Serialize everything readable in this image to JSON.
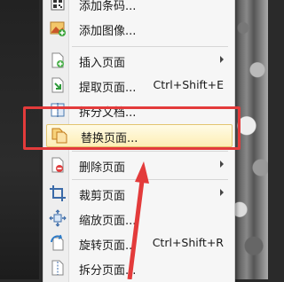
{
  "menu": {
    "items": [
      {
        "label": "添加条码...",
        "shortcut": "",
        "submenu": false,
        "icon": "barcode-icon"
      },
      {
        "label": "添加图像...",
        "shortcut": "",
        "submenu": false,
        "icon": "add-image-icon"
      },
      {
        "label": "插入页面",
        "shortcut": "",
        "submenu": true,
        "icon": "insert-page-icon"
      },
      {
        "label": "提取页面...",
        "shortcut": "Ctrl+Shift+E",
        "submenu": false,
        "icon": "extract-page-icon"
      },
      {
        "label": "拆分文档...",
        "shortcut": "",
        "submenu": false,
        "icon": "split-document-icon"
      },
      {
        "label": "替换页面...",
        "shortcut": "",
        "submenu": false,
        "icon": "replace-page-icon"
      },
      {
        "label": "删除页面",
        "shortcut": "",
        "submenu": true,
        "icon": "delete-page-icon"
      },
      {
        "label": "裁剪页面",
        "shortcut": "",
        "submenu": true,
        "icon": "crop-page-icon"
      },
      {
        "label": "缩放页面...",
        "shortcut": "",
        "submenu": false,
        "icon": "scale-page-icon"
      },
      {
        "label": "旋转页面...",
        "shortcut": "Ctrl+Shift+R",
        "submenu": false,
        "icon": "rotate-page-icon"
      },
      {
        "label": "拆分页面...",
        "shortcut": "",
        "submenu": false,
        "icon": "split-page-icon"
      }
    ],
    "highlighted_index": 5
  },
  "annotation": {
    "box_color": "#e33b3b",
    "arrow_color": "#e33b3b"
  }
}
